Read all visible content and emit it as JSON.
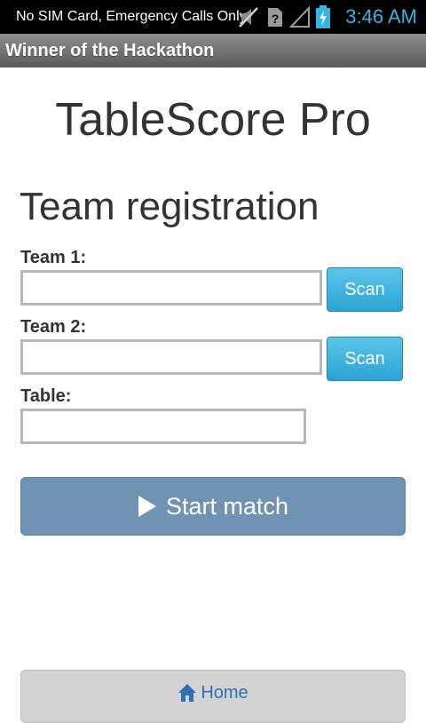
{
  "status_bar": {
    "carrier_text": "No SIM Card, Emergency Calls Only",
    "time": "3:46 AM",
    "icons": [
      "muted-sound-icon",
      "no-sim-icon",
      "empty-signal-icon",
      "charging-battery-icon"
    ],
    "time_color": "#33b5e5"
  },
  "title_bar": {
    "title": "Winner of the Hackathon"
  },
  "app": {
    "title": "TableScore Pro"
  },
  "form": {
    "heading": "Team registration",
    "team1": {
      "label": "Team 1:",
      "value": "",
      "scan_label": "Scan"
    },
    "team2": {
      "label": "Team 2:",
      "value": "",
      "scan_label": "Scan"
    },
    "table": {
      "label": "Table:",
      "value": ""
    },
    "start_button": {
      "label": "Start match",
      "icon": "play-icon"
    }
  },
  "footer": {
    "home_button": {
      "label": "Home",
      "icon": "home-icon"
    }
  },
  "colors": {
    "scan_button": "#2ba3d2",
    "start_button": "#7093b4",
    "home_text": "#2f6fb7",
    "status_bar": "#000000"
  }
}
